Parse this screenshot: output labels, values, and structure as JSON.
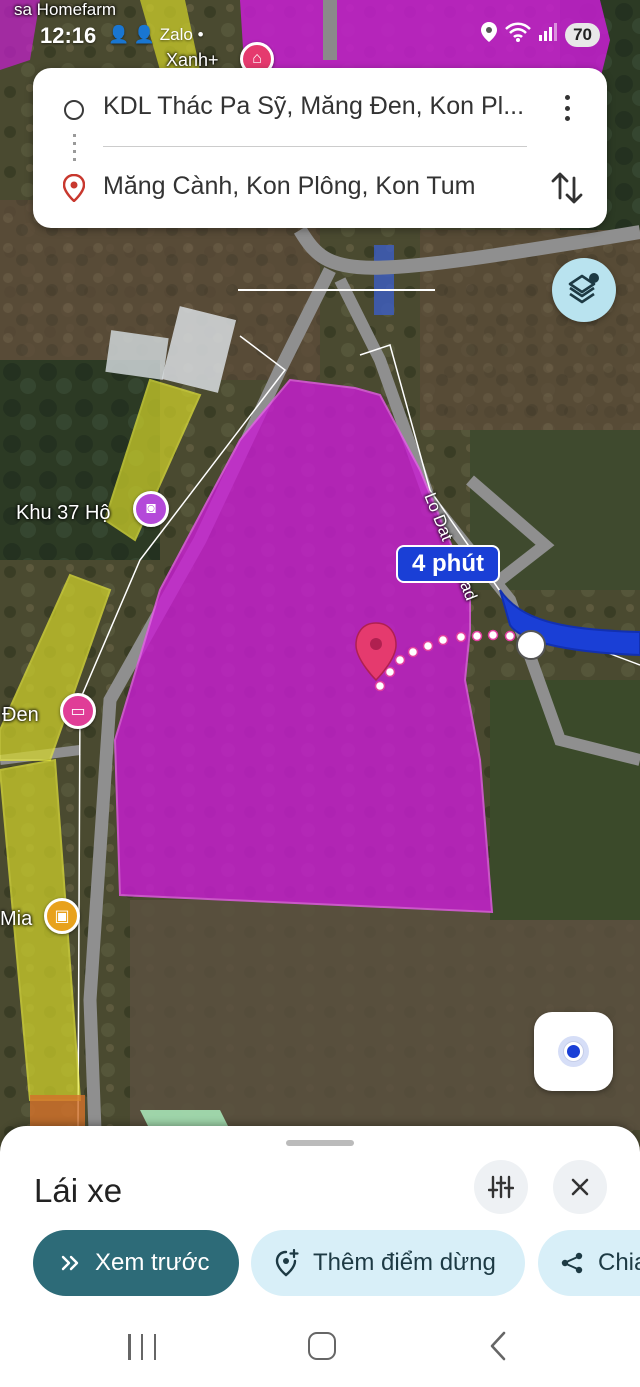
{
  "status_bar": {
    "time": "12:16",
    "left_icons": "👤 👤 Zalo •",
    "battery": "70"
  },
  "route": {
    "origin": "KDL Thác Pa Sỹ, Măng Đen, Kon Pl...",
    "destination": "Măng Cành, Kon Plông, Kon Tum"
  },
  "map": {
    "eta_badge": "4 phút",
    "road_label": "Lo Dat ... Road",
    "labels": {
      "khu37": "Khu 37 Hộ",
      "den": "Đen",
      "mia": "Mia",
      "xanh": "Xanh+",
      "top_left": "sa Homefarm"
    },
    "colors": {
      "area_fill": "#c81ed2",
      "route_blue": "#1a3fd6",
      "zone_yellow": "#d4d62a",
      "pin_red": "#e53a6e"
    }
  },
  "bottom_sheet": {
    "title": "Lái xe",
    "chips": {
      "preview": "Xem trước",
      "add_stop": "Thêm điểm dừng",
      "share": "Chia sẻ"
    }
  }
}
